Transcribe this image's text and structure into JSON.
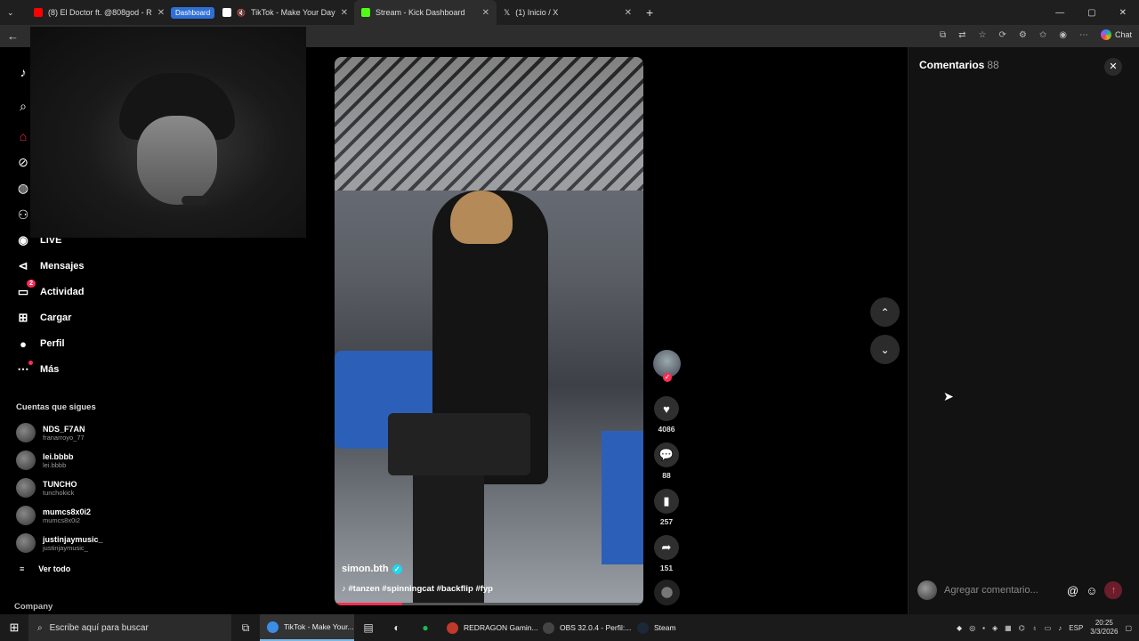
{
  "browser": {
    "tabs": [
      {
        "label": "(8) El Doctor ft. @808god - R",
        "favicon_color": "#ff0000",
        "muted": false
      },
      {
        "label": "Dashboard",
        "pill": true
      },
      {
        "label": "TikTok - Make Your Day",
        "favicon_color": "#ffffff",
        "muted": true
      },
      {
        "label": "Stream - Kick Dashboard",
        "favicon_color": "#53fc18",
        "active": true
      },
      {
        "label": "(1) Inicio / X",
        "favicon_color": "#ffffff"
      }
    ],
    "new_tab": "+",
    "window_controls": [
      "—",
      "▢",
      "✕"
    ],
    "chat_label": "Chat"
  },
  "sidebar": {
    "nav": [
      {
        "label": "LIVE",
        "icon": "live-icon"
      },
      {
        "label": "Mensajes",
        "icon": "messages-icon"
      },
      {
        "label": "Actividad",
        "icon": "activity-icon",
        "badge": "2"
      },
      {
        "label": "Cargar",
        "icon": "upload-icon"
      },
      {
        "label": "Perfil",
        "icon": "profile-icon"
      },
      {
        "label": "Más",
        "icon": "more-icon"
      }
    ],
    "following_title": "Cuentas que sigues",
    "following": [
      {
        "name": "NDS_F7AN",
        "handle": "franarroyo_77"
      },
      {
        "name": "lei.bbbb",
        "handle": "lei.bbbb"
      },
      {
        "name": "TUNCHO",
        "handle": "tunchokick"
      },
      {
        "name": "mumcs8x0i2",
        "handle": "mumcs8x0i2"
      },
      {
        "name": "justinjaymusic_",
        "handle": "justinjaymusic_"
      }
    ],
    "see_all": "Ver todo",
    "company": "Company"
  },
  "video": {
    "username": "simon.bth",
    "hashtags": "#tanzen #spinningcat #backflip #fyp",
    "progress": 0.22,
    "likes": "4086",
    "comments": "88",
    "saves": "257",
    "shares": "151"
  },
  "comments_panel": {
    "title": "Comentarios",
    "count": "88",
    "placeholder": "Agregar comentario..."
  },
  "taskbar": {
    "search_placeholder": "Escribe aquí para buscar",
    "apps": [
      {
        "label": "TikTok - Make Your...",
        "color": "#3a8ee6",
        "active": true
      },
      {
        "label": "REDRAGON Gamin...",
        "color": "#c0392b"
      },
      {
        "label": "OBS 32.0.4 - Perfil:...",
        "color": "#444444"
      },
      {
        "label": "Steam",
        "color": "#1b2838"
      }
    ],
    "language": "ESP",
    "time": "20:25",
    "date": "3/3/2026"
  }
}
